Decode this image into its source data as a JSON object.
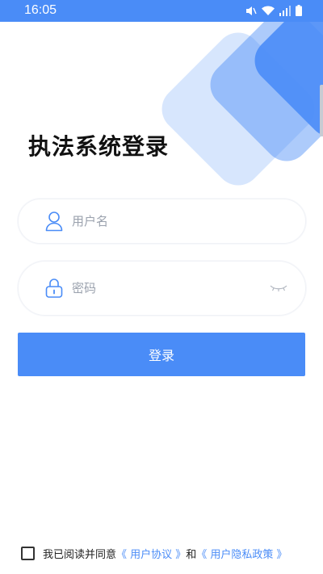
{
  "status_bar": {
    "time": "16:05",
    "icons": [
      "mute-icon",
      "wifi-icon",
      "signal-icon",
      "battery-icon"
    ]
  },
  "title": "执法系统登录",
  "form": {
    "username": {
      "placeholder": "用户名",
      "value": "",
      "icon": "user-icon"
    },
    "password": {
      "placeholder": "密码",
      "value": "",
      "icon": "lock-icon",
      "toggle_icon": "eye-closed-icon"
    },
    "login_label": "登录"
  },
  "agreement": {
    "prefix": "我已阅读并同意",
    "user_agreement": "《 用户协议 》",
    "conjunction": "和",
    "privacy_policy": "《 用户隐私政策 》"
  },
  "colors": {
    "accent": "#4a8cf7",
    "text": "#111111",
    "placeholder": "#9aa1ad"
  }
}
